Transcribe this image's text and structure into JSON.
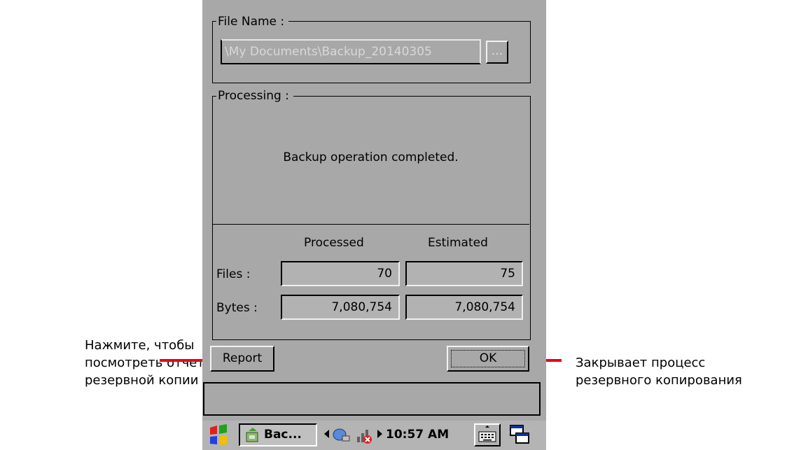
{
  "dialog": {
    "file_group_label": "File Name :",
    "file_path": "\\My Documents\\Backup_20140305",
    "browse_label": "...",
    "processing_group_label": "Processing :",
    "status_message": "Backup operation completed.",
    "col_processed": "Processed",
    "col_estimated": "Estimated",
    "rows": [
      {
        "label": "Files :",
        "processed": "70",
        "estimated": "75"
      },
      {
        "label": "Bytes :",
        "processed": "7,080,754",
        "estimated": "7,080,754"
      }
    ],
    "report_button": "Report",
    "ok_button": "OK"
  },
  "taskbar": {
    "start_icon": "windows-flag-icon",
    "app_button": "Bac...",
    "time": "10:57 AM",
    "icons": [
      "backup-app-icon",
      "left-arrow-icon",
      "network-icon",
      "signal-off-icon",
      "right-arrow-icon",
      "keyboard-icon",
      "windows-switch-icon"
    ]
  },
  "annotations": {
    "left_line1": "Нажмите, чтобы",
    "left_line2": "посмотреть отчет о",
    "left_line3": "резервной копии",
    "right_line1": "Закрывает процесс",
    "right_line2": "резервного копирования"
  },
  "colors": {
    "screen_bg": "#a8a8a8",
    "annotation_line": "#e8001c",
    "taskbar_bg": "#b4b4b4"
  }
}
